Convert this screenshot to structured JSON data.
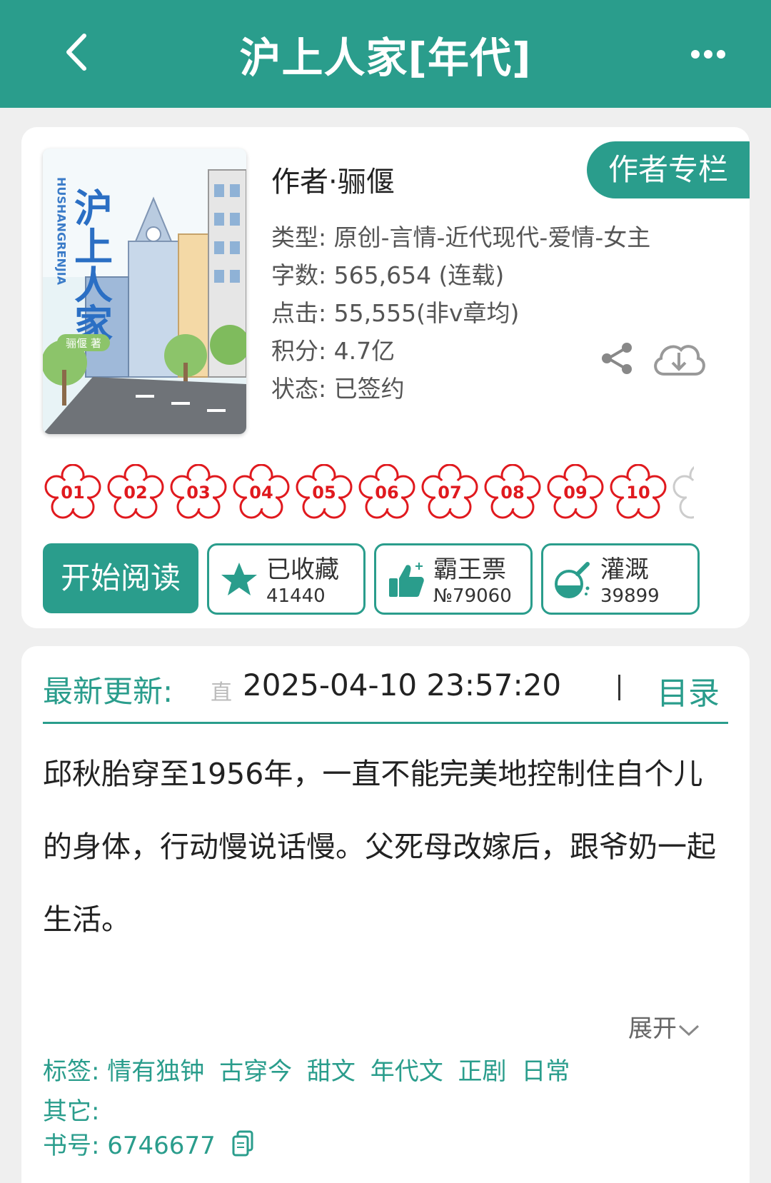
{
  "header": {
    "title": "沪上人家[年代]",
    "back_icon": "chevron-left-icon",
    "more_icon": "more-dots-icon",
    "background": "#2a9d8c"
  },
  "book": {
    "cover": {
      "title_text": "沪上人家",
      "pinyin": "HUSHANGRENJIA",
      "author_stamp": "骊偃 著"
    },
    "author": "作者·骊偃",
    "author_column_button": "作者专栏",
    "type": "类型: 原创-言情-近代现代-爱情-女主",
    "word_count": "字数: 565,654 (连载)",
    "clicks": "点击: 55,555(非v章均)",
    "points": "积分: 4.7亿",
    "status": "状态: 已签约",
    "share_icon": "share-icon",
    "download_icon": "cloud-download-icon"
  },
  "badges": [
    "01",
    "02",
    "03",
    "04",
    "05",
    "06",
    "07",
    "08",
    "09",
    "10"
  ],
  "actions": {
    "start_reading": "开始阅读",
    "favorite": {
      "label": "已收藏",
      "count": "41440",
      "icon": "star-icon"
    },
    "vote": {
      "label": "霸王票",
      "count": "№79060",
      "icon": "thumbs-up-icon"
    },
    "nutrient": {
      "label": "灌溉",
      "count": "39899",
      "icon": "flask-icon"
    }
  },
  "update": {
    "label": "最新更新:",
    "glyph": "直",
    "time": "2025-04-10 23:57:20",
    "catalog": "目录"
  },
  "summary": "邱秋胎穿至1956年，一直不能完美地控制住自个儿的身体，行动慢说话慢。父死母改嫁后，跟爷奶一起生活。",
  "expand": "展开",
  "tags": {
    "label": "标签:",
    "items": [
      "情有独钟",
      "古穿今",
      "甜文",
      "年代文",
      "正剧",
      "日常"
    ]
  },
  "other": {
    "label": "其它:"
  },
  "book_id": {
    "label": "书号:",
    "value": "6746677"
  },
  "colors": {
    "accent": "#2a9d8c",
    "badge_red": "#e0191e"
  }
}
